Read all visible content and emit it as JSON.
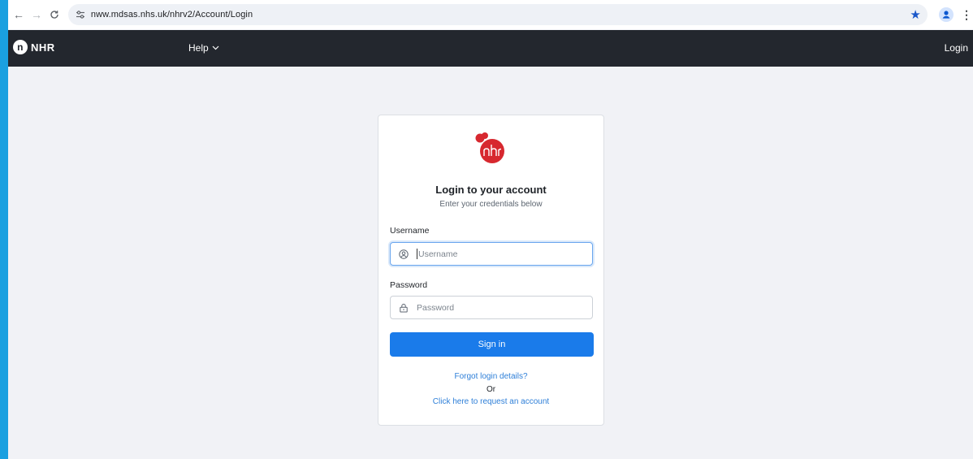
{
  "browser": {
    "url": "nww.mdsas.nhs.uk/nhrv2/Account/Login"
  },
  "navbar": {
    "brand": "NHR",
    "help_label": "Help",
    "login_label": "Login"
  },
  "login": {
    "title": "Login to your account",
    "subtitle": "Enter your credentials below",
    "username_label": "Username",
    "username_placeholder": "Username",
    "password_label": "Password",
    "password_placeholder": "Password",
    "signin_label": "Sign in",
    "forgot_label": "Forgot login details?",
    "or_label": "Or",
    "request_label": "Click here to request an account"
  },
  "colors": {
    "navbar_bg": "#23272e",
    "primary": "#1a7bea",
    "link": "#2e7fd8",
    "logo_red": "#d7282f"
  }
}
